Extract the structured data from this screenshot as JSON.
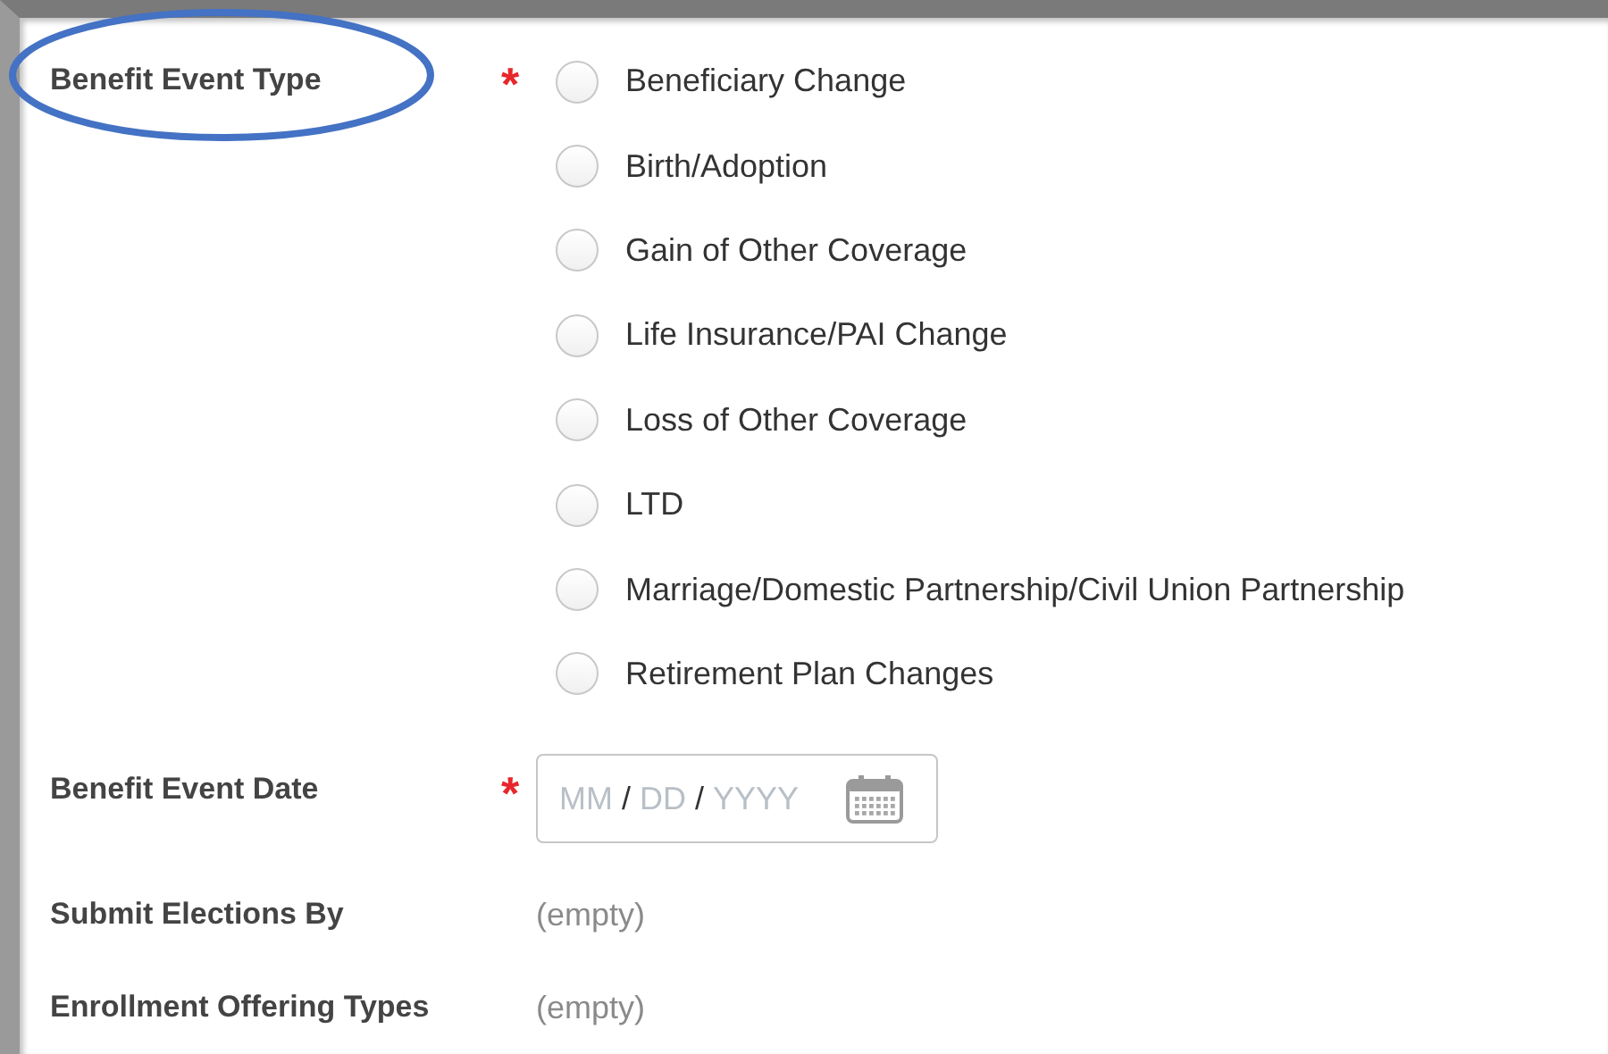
{
  "fields": [
    {
      "kind": "radio_group",
      "label": "Benefit Event Type",
      "required_mark": "*",
      "highlighted": true,
      "options": [
        {
          "label": "Beneficiary Change",
          "selected": false
        },
        {
          "label": "Birth/Adoption",
          "selected": false
        },
        {
          "label": "Gain of Other Coverage",
          "selected": false
        },
        {
          "label": "Life Insurance/PAI Change",
          "selected": false
        },
        {
          "label": "Loss of Other Coverage",
          "selected": false
        },
        {
          "label": "LTD",
          "selected": false
        },
        {
          "label": "Marriage/Domestic Partnership/Civil Union Partnership",
          "selected": false
        },
        {
          "label": "Retirement Plan Changes",
          "selected": false
        }
      ]
    },
    {
      "kind": "date",
      "label": "Benefit Event Date",
      "required_mark": "*",
      "highlighted": false,
      "segments": [
        {
          "kind": "hint",
          "text": "MM"
        },
        {
          "kind": "sep",
          "text": "/"
        },
        {
          "kind": "hint",
          "text": "DD"
        },
        {
          "kind": "sep",
          "text": "/"
        },
        {
          "kind": "hint",
          "text": "YYYY"
        }
      ]
    },
    {
      "kind": "readonly",
      "label": "Submit Elections By",
      "highlighted": false,
      "value": "(empty)"
    },
    {
      "kind": "readonly",
      "label": "Enrollment Offering Types",
      "highlighted": false,
      "value": "(empty)"
    }
  ]
}
